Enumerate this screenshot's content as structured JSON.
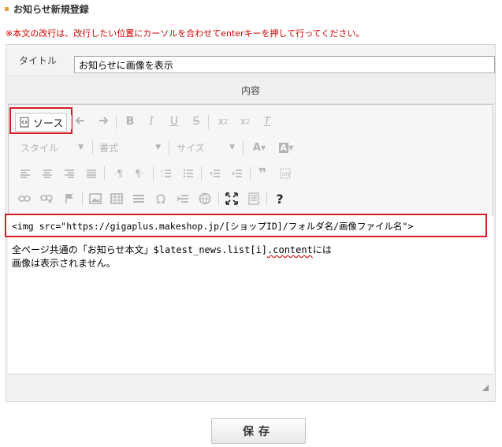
{
  "page": {
    "title": "お知らせ新規登録",
    "notice": "※本文の改行は、改行したい位置にカーソルを合わせてenterキーを押して行ってください。"
  },
  "form": {
    "title_label": "タイトル",
    "title_value": "お知らせに画像を表示",
    "content_label": "内容"
  },
  "toolbar": {
    "source_label": "ソース",
    "row1": [
      "undo-icon",
      "redo-icon",
      "bold-icon",
      "italic-icon",
      "underline-icon",
      "strikethrough-icon",
      "subscript-icon",
      "superscript-icon",
      "remove-format-icon"
    ],
    "style_combo": "スタイル",
    "format_combo": "書式",
    "size_combo": "サイズ",
    "row3": [
      "align-left-icon",
      "align-center-icon",
      "align-right-icon",
      "justify-icon",
      "ltr-icon",
      "rtl-icon",
      "numbered-list-icon",
      "bulleted-list-icon",
      "outdent-icon",
      "indent-icon",
      "blockquote-icon",
      "create-div-icon"
    ],
    "row4": [
      "link-icon",
      "unlink-icon",
      "anchor-icon",
      "image-icon",
      "table-icon",
      "horizontal-rule-icon",
      "special-char-icon",
      "page-break-icon",
      "iframe-icon",
      "maximize-icon",
      "show-blocks-icon",
      "help-icon"
    ],
    "help_glyph": "?"
  },
  "editor": {
    "code_line": "<img src=\"https://gigaplus.makeshop.jp/[ショップID]/フォルダ名/画像ファイル名\">",
    "body_line1_prefix": "全ページ共通の「お知らせ本文」$latest_news.list[i]",
    "body_line1_squiggle": ".content",
    "body_line1_suffix": "には",
    "body_line2": "画像は表示されません。"
  },
  "actions": {
    "save_label": "保存"
  },
  "colors": {
    "highlight_red": "#d81f26",
    "notice_red": "#cc0000",
    "bullet_orange": "#f0a030"
  }
}
